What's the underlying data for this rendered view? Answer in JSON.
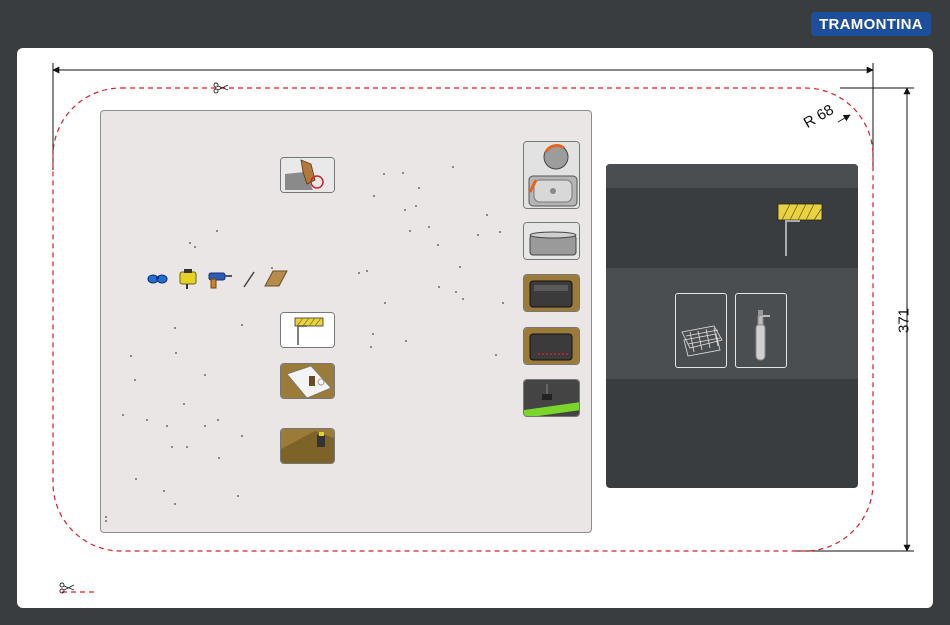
{
  "brand": {
    "logo_text": "TRAMONTINA",
    "color": "#1d4f9b"
  },
  "template": {
    "width_dimension": "",
    "height_dimension": "371",
    "corner_radius_label": "R 68",
    "cut_line_color": "#d4202a"
  },
  "icons": {
    "tools": [
      "safety-goggles-icon",
      "jigsaw-icon",
      "drill-icon",
      "pencil-icon",
      "wood-block-icon"
    ],
    "cut_markers": [
      "scissors-icon",
      "scissors-icon"
    ]
  },
  "steps": {
    "left": [
      "hand-marking-icon",
      "countertop-section-icon",
      "template-placement-icon",
      "cutting-icon"
    ],
    "right": [
      "sink-clip-icon",
      "sink-bowl-icon",
      "sink-insert-icon",
      "sink-sealant-icon",
      "sink-fixing-icon"
    ]
  },
  "accessories": [
    "wire-basket-icon",
    "soap-dispenser-icon"
  ]
}
